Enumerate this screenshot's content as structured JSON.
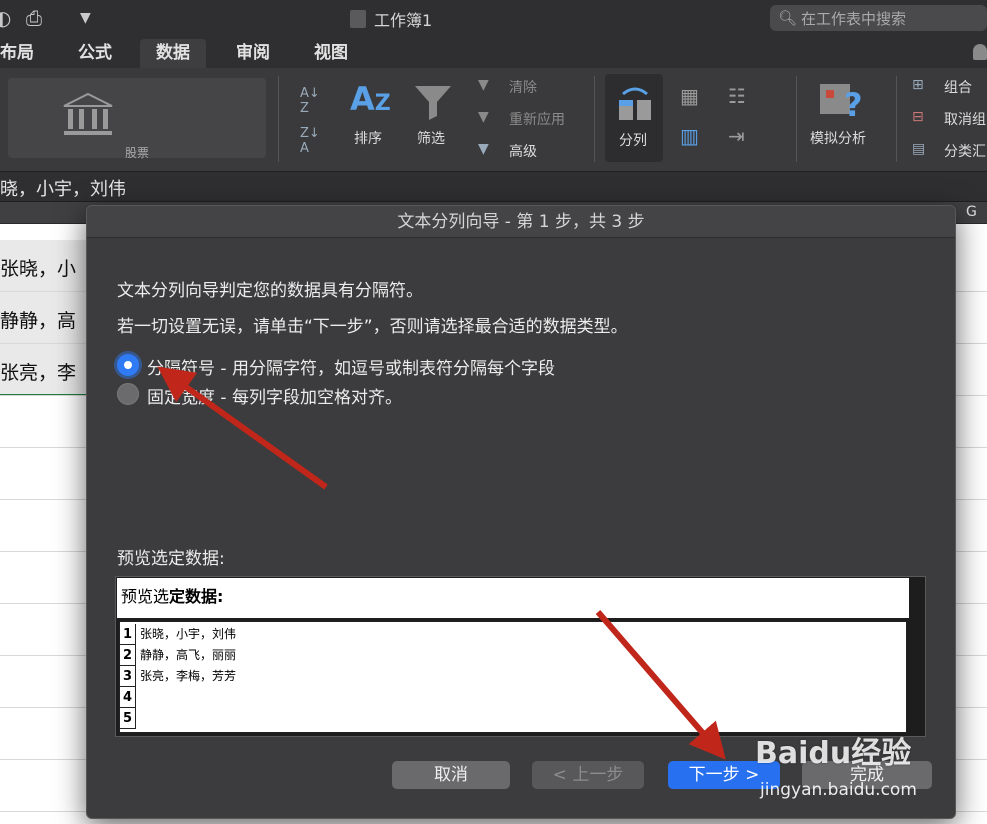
{
  "titlebar": {
    "document_title": "工作簿1",
    "search_placeholder": "在工作表中搜索"
  },
  "tabs": [
    {
      "label": "布局",
      "active": false
    },
    {
      "label": "公式",
      "active": false
    },
    {
      "label": "数据",
      "active": true
    },
    {
      "label": "审阅",
      "active": false
    },
    {
      "label": "视图",
      "active": false
    }
  ],
  "ribbon": {
    "stock_label": "股票",
    "sort_label": "排序",
    "filter_label": "筛选",
    "clear_label": "清除",
    "reapply_label": "重新应用",
    "advanced_label": "高级",
    "text_to_columns_label": "分列",
    "whatif_label": "模拟分析",
    "group_label": "组合",
    "ungroup_label": "取消组",
    "subtotal_label": "分类汇"
  },
  "formula_bar": {
    "content": "晓，小宇，刘伟"
  },
  "sheet": {
    "column_header_g": "G",
    "rows": [
      "张晓，小",
      "静静，高",
      "张亮，李"
    ]
  },
  "dialog": {
    "title": "文本分列向导 - 第 1 步，共 3 步",
    "intro_line1": "文本分列向导判定您的数据具有分隔符。",
    "intro_line2": "若一切设置无误，请单击“下一步”，否则请选择最合适的数据类型。",
    "option_delimited": "分隔符号 - 用分隔字符，如逗号或制表符分隔每个字段",
    "option_fixed": "固定宽度 - 每列字段加空格对齐。",
    "preview_label": "预览选定数据:",
    "preview_header_normal": "预览选",
    "preview_header_bold": "定数据:",
    "preview_rows": [
      {
        "num": "1",
        "text": "张晓，小宇，刘伟"
      },
      {
        "num": "2",
        "text": "静静，高飞，丽丽"
      },
      {
        "num": "3",
        "text": "张亮，李梅，芳芳"
      },
      {
        "num": "4",
        "text": ""
      },
      {
        "num": "5",
        "text": ""
      }
    ],
    "btn_cancel": "取消",
    "btn_prev": "< 上一步",
    "btn_next": "下一步 >",
    "btn_finish": "完成"
  },
  "watermark": {
    "main": "Baidu经验",
    "sub": "jingyan.baidu.com"
  },
  "colors": {
    "accent": "#2771f0",
    "arrow": "#c0261a",
    "selection_border": "#1e7f3c"
  }
}
